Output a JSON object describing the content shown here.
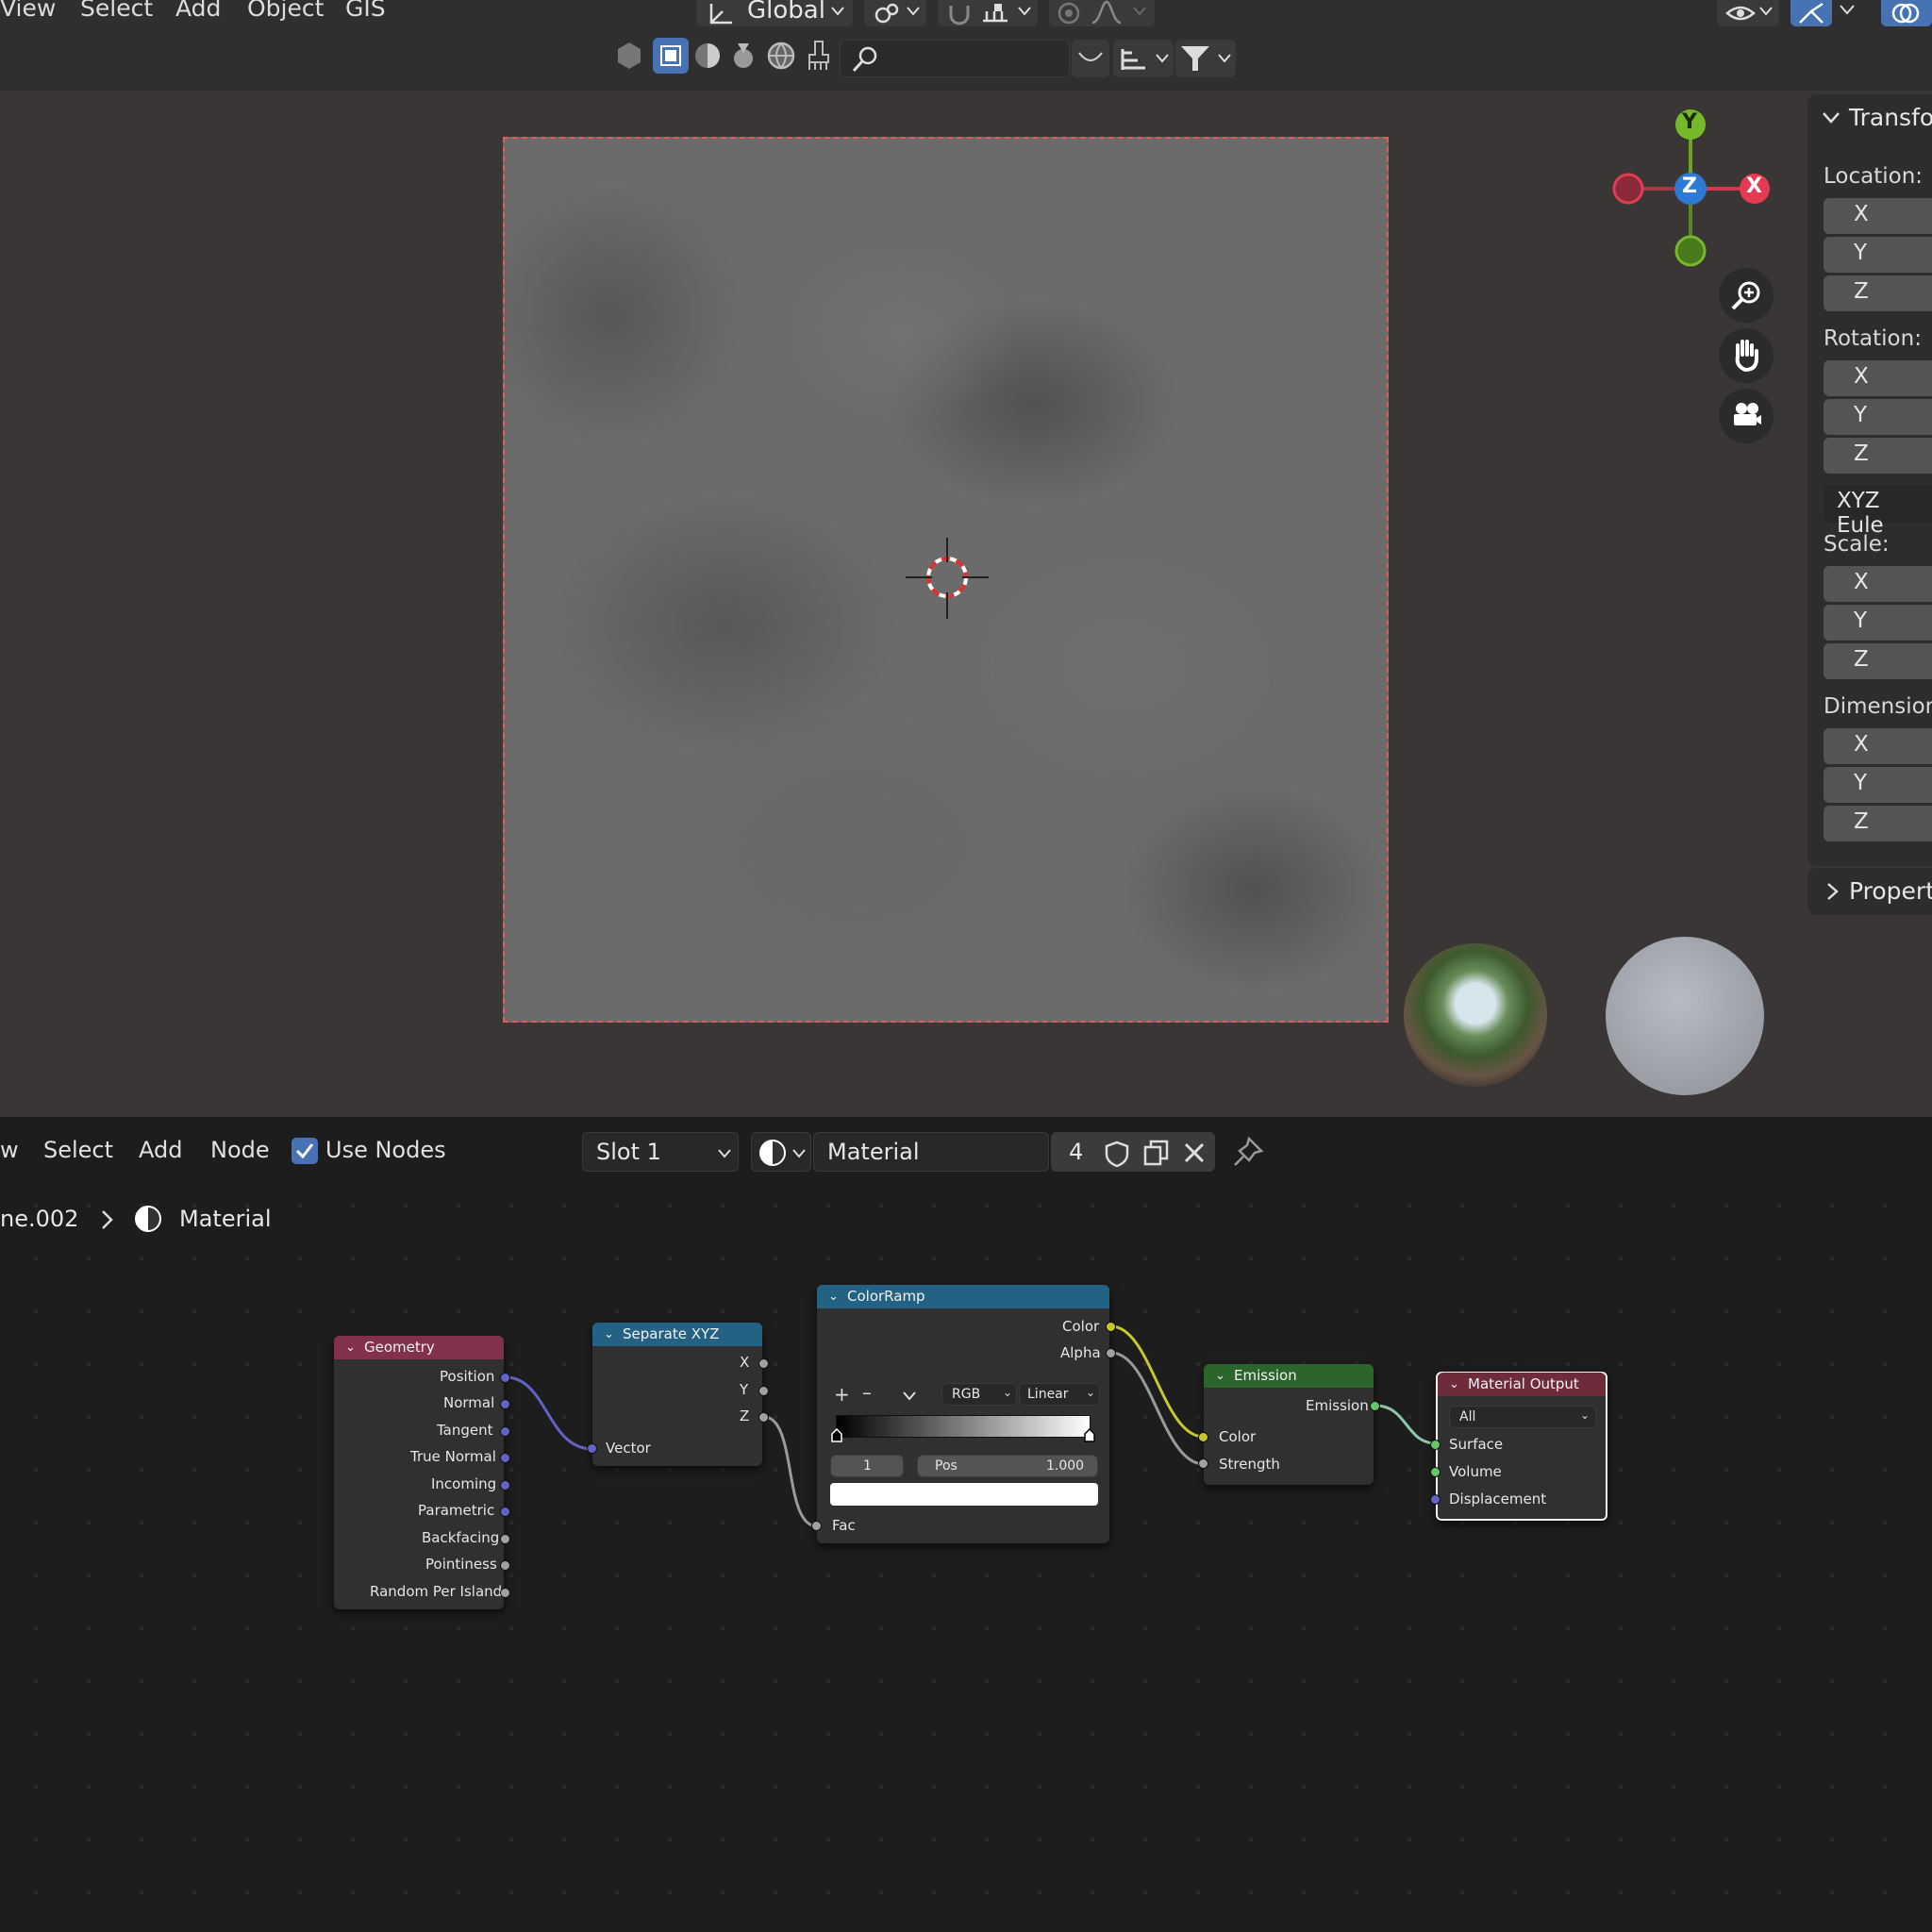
{
  "viewport": {
    "menu": [
      "View",
      "Select",
      "Add",
      "Object",
      "GIS"
    ],
    "orientation": "Global",
    "gizmo": {
      "y": "Y",
      "z": "Z",
      "x": "X"
    }
  },
  "n_panel": {
    "transform": "Transfor",
    "location": "Location:",
    "rotation": "Rotation:",
    "rotation_mode": "XYZ Eule",
    "scale": "Scale:",
    "dimensions": "Dimension",
    "properties": "Properti",
    "axes": [
      "X",
      "Y",
      "Z"
    ]
  },
  "node_editor": {
    "menu": [
      "w",
      "Select",
      "Add",
      "Node"
    ],
    "use_nodes": "Use Nodes",
    "slot": "Slot 1",
    "material_name": "Material",
    "users": "4",
    "breadcrumb_object": "ne.002",
    "breadcrumb_material": "Material"
  },
  "nodes": {
    "geometry": {
      "title": "Geometry",
      "outputs": [
        "Position",
        "Normal",
        "Tangent",
        "True Normal",
        "Incoming",
        "Parametric",
        "Backfacing",
        "Pointiness",
        "Random Per Island"
      ]
    },
    "separate": {
      "title": "Separate XYZ",
      "outputs": [
        "X",
        "Y",
        "Z"
      ],
      "input": "Vector"
    },
    "colorramp": {
      "title": "ColorRamp",
      "outputs": [
        "Color",
        "Alpha"
      ],
      "color_mode": "RGB",
      "interpolation": "Linear",
      "index": "1",
      "pos_label": "Pos",
      "pos_value": "1.000",
      "input": "Fac"
    },
    "emission": {
      "title": "Emission",
      "output": "Emission",
      "inputs": [
        "Color",
        "Strength"
      ]
    },
    "output": {
      "title": "Material Output",
      "target": "All",
      "inputs": [
        "Surface",
        "Volume",
        "Displacement"
      ]
    }
  },
  "colors": {
    "accent": "#4772b3",
    "geometry_header": "#83314a",
    "converter_header": "#246283",
    "shader_header": "#2b652b",
    "output_header": "#6e2b3a"
  }
}
